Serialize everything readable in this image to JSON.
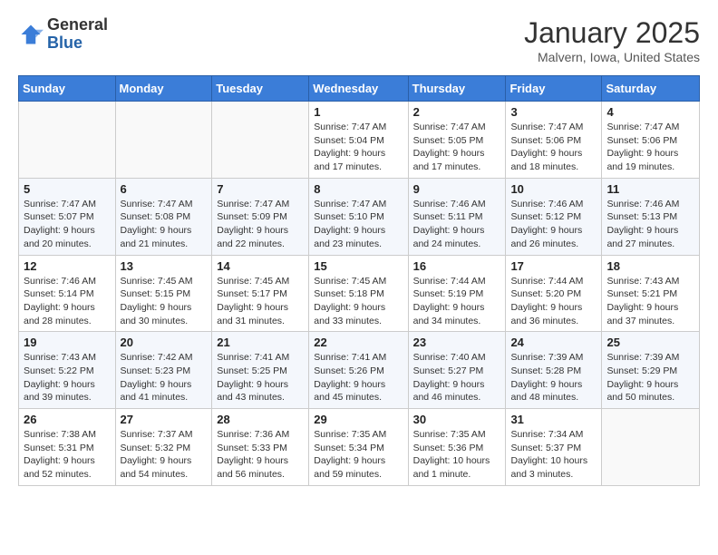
{
  "header": {
    "logo_general": "General",
    "logo_blue": "Blue",
    "month_year": "January 2025",
    "location": "Malvern, Iowa, United States"
  },
  "days_of_week": [
    "Sunday",
    "Monday",
    "Tuesday",
    "Wednesday",
    "Thursday",
    "Friday",
    "Saturday"
  ],
  "weeks": [
    [
      {
        "day": "",
        "info": ""
      },
      {
        "day": "",
        "info": ""
      },
      {
        "day": "",
        "info": ""
      },
      {
        "day": "1",
        "info": "Sunrise: 7:47 AM\nSunset: 5:04 PM\nDaylight: 9 hours\nand 17 minutes."
      },
      {
        "day": "2",
        "info": "Sunrise: 7:47 AM\nSunset: 5:05 PM\nDaylight: 9 hours\nand 17 minutes."
      },
      {
        "day": "3",
        "info": "Sunrise: 7:47 AM\nSunset: 5:06 PM\nDaylight: 9 hours\nand 18 minutes."
      },
      {
        "day": "4",
        "info": "Sunrise: 7:47 AM\nSunset: 5:06 PM\nDaylight: 9 hours\nand 19 minutes."
      }
    ],
    [
      {
        "day": "5",
        "info": "Sunrise: 7:47 AM\nSunset: 5:07 PM\nDaylight: 9 hours\nand 20 minutes."
      },
      {
        "day": "6",
        "info": "Sunrise: 7:47 AM\nSunset: 5:08 PM\nDaylight: 9 hours\nand 21 minutes."
      },
      {
        "day": "7",
        "info": "Sunrise: 7:47 AM\nSunset: 5:09 PM\nDaylight: 9 hours\nand 22 minutes."
      },
      {
        "day": "8",
        "info": "Sunrise: 7:47 AM\nSunset: 5:10 PM\nDaylight: 9 hours\nand 23 minutes."
      },
      {
        "day": "9",
        "info": "Sunrise: 7:46 AM\nSunset: 5:11 PM\nDaylight: 9 hours\nand 24 minutes."
      },
      {
        "day": "10",
        "info": "Sunrise: 7:46 AM\nSunset: 5:12 PM\nDaylight: 9 hours\nand 26 minutes."
      },
      {
        "day": "11",
        "info": "Sunrise: 7:46 AM\nSunset: 5:13 PM\nDaylight: 9 hours\nand 27 minutes."
      }
    ],
    [
      {
        "day": "12",
        "info": "Sunrise: 7:46 AM\nSunset: 5:14 PM\nDaylight: 9 hours\nand 28 minutes."
      },
      {
        "day": "13",
        "info": "Sunrise: 7:45 AM\nSunset: 5:15 PM\nDaylight: 9 hours\nand 30 minutes."
      },
      {
        "day": "14",
        "info": "Sunrise: 7:45 AM\nSunset: 5:17 PM\nDaylight: 9 hours\nand 31 minutes."
      },
      {
        "day": "15",
        "info": "Sunrise: 7:45 AM\nSunset: 5:18 PM\nDaylight: 9 hours\nand 33 minutes."
      },
      {
        "day": "16",
        "info": "Sunrise: 7:44 AM\nSunset: 5:19 PM\nDaylight: 9 hours\nand 34 minutes."
      },
      {
        "day": "17",
        "info": "Sunrise: 7:44 AM\nSunset: 5:20 PM\nDaylight: 9 hours\nand 36 minutes."
      },
      {
        "day": "18",
        "info": "Sunrise: 7:43 AM\nSunset: 5:21 PM\nDaylight: 9 hours\nand 37 minutes."
      }
    ],
    [
      {
        "day": "19",
        "info": "Sunrise: 7:43 AM\nSunset: 5:22 PM\nDaylight: 9 hours\nand 39 minutes."
      },
      {
        "day": "20",
        "info": "Sunrise: 7:42 AM\nSunset: 5:23 PM\nDaylight: 9 hours\nand 41 minutes."
      },
      {
        "day": "21",
        "info": "Sunrise: 7:41 AM\nSunset: 5:25 PM\nDaylight: 9 hours\nand 43 minutes."
      },
      {
        "day": "22",
        "info": "Sunrise: 7:41 AM\nSunset: 5:26 PM\nDaylight: 9 hours\nand 45 minutes."
      },
      {
        "day": "23",
        "info": "Sunrise: 7:40 AM\nSunset: 5:27 PM\nDaylight: 9 hours\nand 46 minutes."
      },
      {
        "day": "24",
        "info": "Sunrise: 7:39 AM\nSunset: 5:28 PM\nDaylight: 9 hours\nand 48 minutes."
      },
      {
        "day": "25",
        "info": "Sunrise: 7:39 AM\nSunset: 5:29 PM\nDaylight: 9 hours\nand 50 minutes."
      }
    ],
    [
      {
        "day": "26",
        "info": "Sunrise: 7:38 AM\nSunset: 5:31 PM\nDaylight: 9 hours\nand 52 minutes."
      },
      {
        "day": "27",
        "info": "Sunrise: 7:37 AM\nSunset: 5:32 PM\nDaylight: 9 hours\nand 54 minutes."
      },
      {
        "day": "28",
        "info": "Sunrise: 7:36 AM\nSunset: 5:33 PM\nDaylight: 9 hours\nand 56 minutes."
      },
      {
        "day": "29",
        "info": "Sunrise: 7:35 AM\nSunset: 5:34 PM\nDaylight: 9 hours\nand 59 minutes."
      },
      {
        "day": "30",
        "info": "Sunrise: 7:35 AM\nSunset: 5:36 PM\nDaylight: 10 hours\nand 1 minute."
      },
      {
        "day": "31",
        "info": "Sunrise: 7:34 AM\nSunset: 5:37 PM\nDaylight: 10 hours\nand 3 minutes."
      },
      {
        "day": "",
        "info": ""
      }
    ]
  ]
}
